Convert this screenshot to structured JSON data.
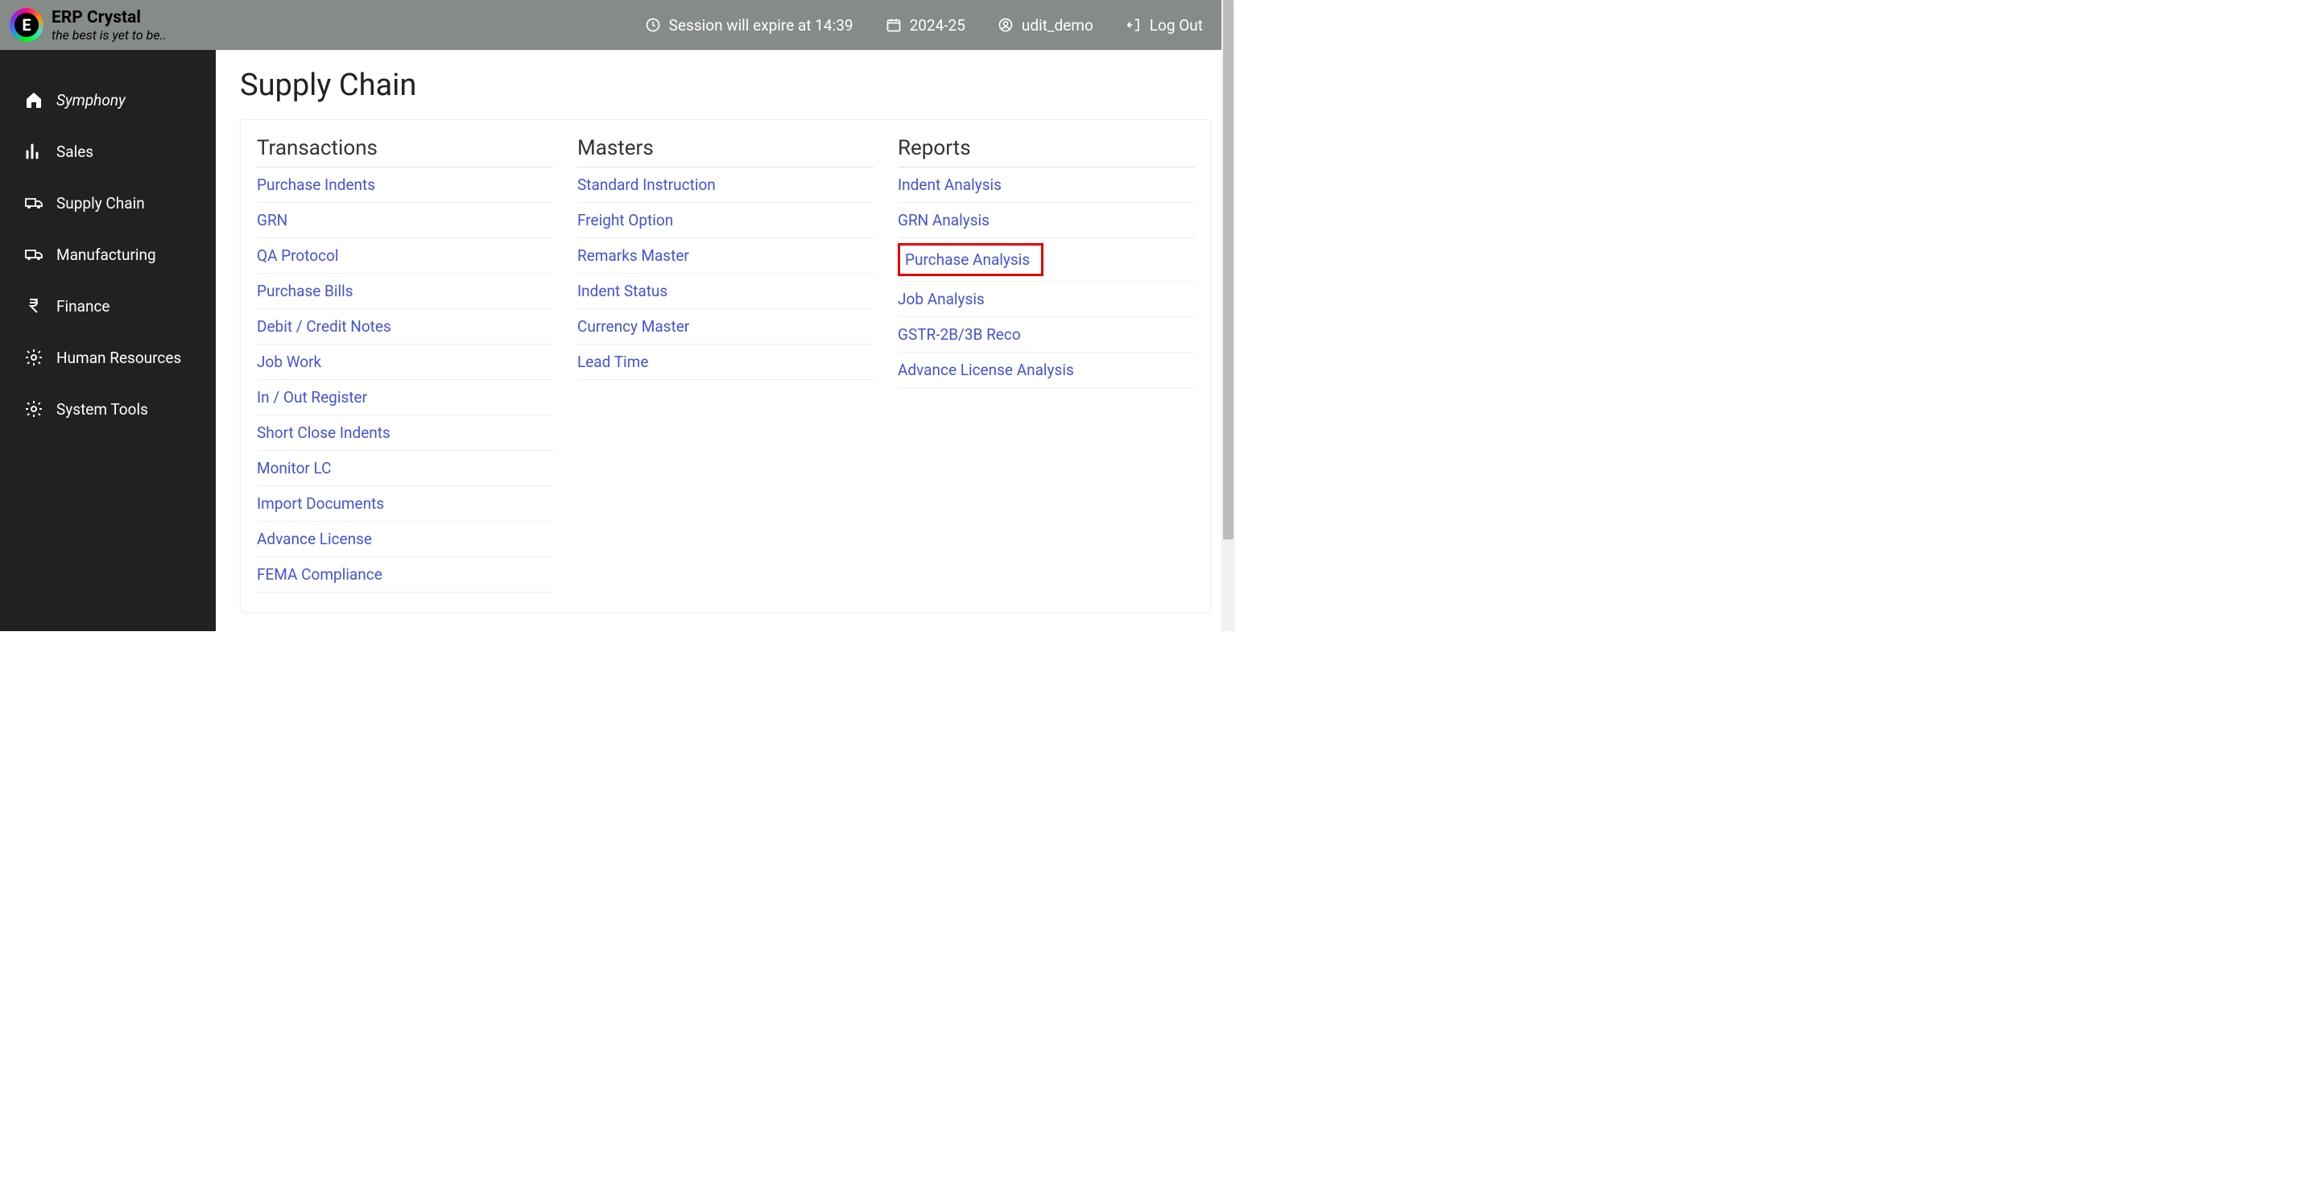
{
  "brand": {
    "name": "ERP Crystal",
    "tagline": "the best is yet to be.."
  },
  "header": {
    "session": "Session will expire at 14:39",
    "fy": "2024-25",
    "user": "udit_demo",
    "logout": "Log Out"
  },
  "sidebar": {
    "items": [
      {
        "id": "symphony",
        "label": "Symphony",
        "icon": "home"
      },
      {
        "id": "sales",
        "label": "Sales",
        "icon": "bar-chart"
      },
      {
        "id": "supply-chain",
        "label": "Supply Chain",
        "icon": "truck"
      },
      {
        "id": "manufacturing",
        "label": "Manufacturing",
        "icon": "truck"
      },
      {
        "id": "finance",
        "label": "Finance",
        "icon": "rupee"
      },
      {
        "id": "hr",
        "label": "Human Resources",
        "icon": "gear"
      },
      {
        "id": "system-tools",
        "label": "System Tools",
        "icon": "gear"
      }
    ]
  },
  "page": {
    "title": "Supply Chain",
    "columns": [
      {
        "title": "Transactions",
        "items": [
          "Purchase Indents",
          "GRN",
          "QA Protocol",
          "Purchase Bills",
          "Debit / Credit Notes",
          "Job Work",
          "In / Out Register",
          "Short Close Indents",
          "Monitor LC",
          "Import Documents",
          "Advance License",
          "FEMA Compliance"
        ]
      },
      {
        "title": "Masters",
        "items": [
          "Standard Instruction",
          "Freight Option",
          "Remarks Master",
          "Indent Status",
          "Currency Master",
          "Lead Time"
        ]
      },
      {
        "title": "Reports",
        "items": [
          "Indent Analysis",
          "GRN Analysis",
          "Purchase Analysis",
          "Job Analysis",
          "GSTR-2B/3B Reco",
          "Advance License Analysis"
        ],
        "highlightIndex": 2
      }
    ]
  }
}
